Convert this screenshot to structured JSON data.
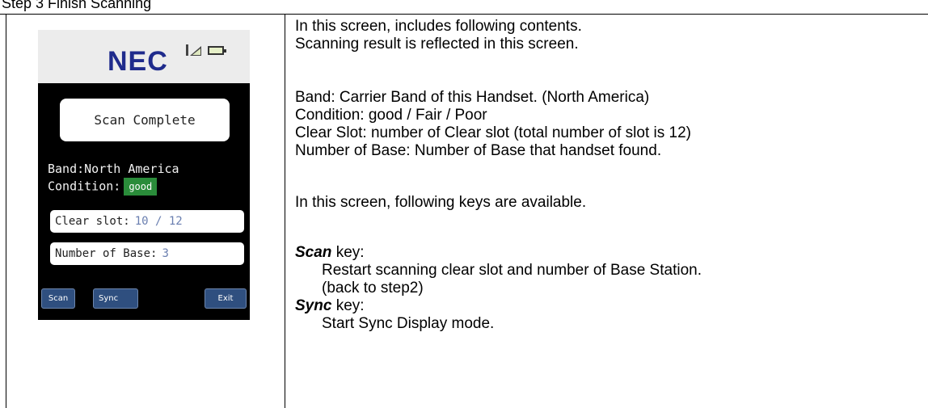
{
  "heading": "Step 3  Finish Scanning",
  "phone": {
    "logo": "NEC",
    "scan_status": "Scan Complete",
    "band_line": "Band:North America",
    "condition_label": "Condition:",
    "condition_value": "good",
    "clear_slot_label": "Clear slot:",
    "clear_slot_value": "10 / 12",
    "base_label": "Number of Base:",
    "base_value": "3",
    "softkeys": {
      "scan": "Scan",
      "sync": "Sync",
      "exit": "Exit"
    },
    "icons": [
      "signal-icon",
      "battery-icon"
    ]
  },
  "description": {
    "intro1": "In this screen, includes following contents.",
    "intro2": "Scanning result is reflected in this screen.",
    "band": "Band: Carrier Band of this Handset. (North America)",
    "condition": "Condition: good / Fair / Poor",
    "clear_slot": "Clear Slot: number of Clear slot (total number of slot is 12)",
    "number_of_base": "Number of Base: Number of Base that handset found.",
    "keys_intro": "In this screen, following keys are available.",
    "scan_key_name": "Scan",
    "key_suffix": " key:",
    "scan_key_desc1": "Restart scanning clear slot and number of Base Station.",
    "scan_key_desc2": "(back to step2)",
    "sync_key_name": "Sync",
    "sync_key_desc": "Start Sync Display mode."
  }
}
